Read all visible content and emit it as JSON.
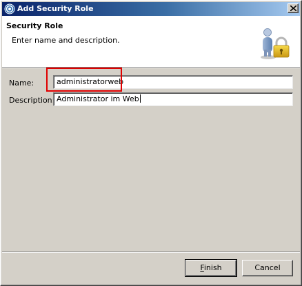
{
  "window": {
    "title": "Add Security Role"
  },
  "header": {
    "title": "Security Role",
    "description": "Enter name and description.",
    "banner_icon": "user-lock-icon"
  },
  "form": {
    "name_label": "Name:",
    "name_value": "administratorweb",
    "description_label": "Description:",
    "description_value": "Administrator im Web"
  },
  "buttons": {
    "finish_mnemonic": "F",
    "finish_rest": "inish",
    "cancel_label": "Cancel"
  },
  "colors": {
    "titlebar_start": "#0a246a",
    "titlebar_end": "#a6caf0",
    "highlight": "#e00000",
    "dialog_bg": "#d4d0c8"
  }
}
